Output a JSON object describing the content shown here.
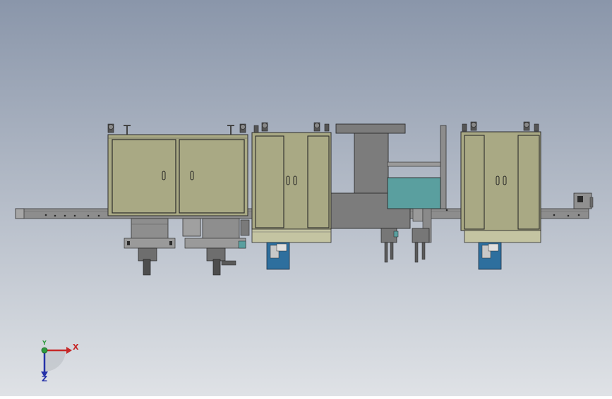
{
  "scene": {
    "background_top": "#8a96aa",
    "background_bottom": "#dfe2e6",
    "cabinet_color": "#a9a984",
    "frame_color": "#8d8d8d",
    "drum_color": "#7c7c7c",
    "tank_color": "#5a9f9f",
    "motor_color": "#2e6f9e"
  },
  "triad": {
    "x_label": "X",
    "y_label": "Y",
    "z_label": "Z",
    "x_color": "#c62828",
    "y_color": "#2e9b3e",
    "z_color": "#2431a8"
  }
}
